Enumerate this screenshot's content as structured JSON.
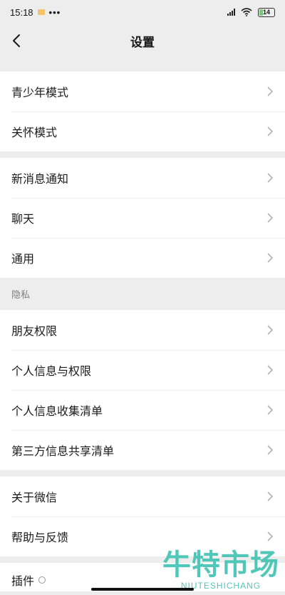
{
  "status_bar": {
    "time": "15:18",
    "dots": "•••",
    "battery": "14"
  },
  "nav": {
    "title": "设置"
  },
  "groups": [
    {
      "items": [
        "青少年模式",
        "关怀模式"
      ]
    },
    {
      "items": [
        "新消息通知",
        "聊天",
        "通用"
      ]
    },
    {
      "label": "隐私",
      "items": [
        "朋友权限",
        "个人信息与权限",
        "个人信息收集清单",
        "第三方信息共享清单"
      ]
    },
    {
      "items": [
        "关于微信",
        "帮助与反馈"
      ]
    }
  ],
  "partial_item": "插件",
  "watermark": {
    "main": "牛特市场",
    "sub": "NIUTESHICHANG"
  },
  "colors": {
    "background": "#ededed",
    "cell": "#ffffff",
    "chevron": "#b2b2b2",
    "watermark": "#3ec2b1"
  }
}
